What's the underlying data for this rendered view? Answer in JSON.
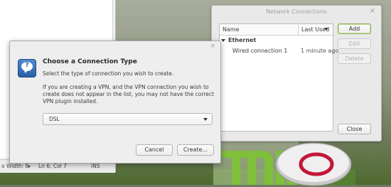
{
  "editor": {
    "status": {
      "tab_width": "o Width: 8",
      "position": "Ln 6, Col 7",
      "mode": "INS"
    }
  },
  "network_connections": {
    "title": "Network Connections",
    "close_glyph": "×",
    "columns": {
      "name": "Name",
      "last_used": "Last Used"
    },
    "group": "Ethernet",
    "connections": [
      {
        "name": "Wired connection 1",
        "last_used": "1 minute ago"
      }
    ],
    "buttons": {
      "add": "Add",
      "edit": "Edit",
      "delete": "Delete",
      "close": "Close"
    }
  },
  "dialog": {
    "close_glyph": "×",
    "heading": "Choose a Connection Type",
    "subtitle": "Select the type of connection you wish to create.",
    "paragraph": "If you are creating a VPN, and the VPN connection you wish to create does not appear in the list, you may not have the correct VPN plugin installed.",
    "select_value": "DSL",
    "icon": "question-bubble-icon",
    "buttons": {
      "cancel": "Cancel",
      "create": "Create..."
    }
  },
  "colors": {
    "default_button_border": "#8bb14f",
    "dialog_icon": "#2b5fa5"
  }
}
